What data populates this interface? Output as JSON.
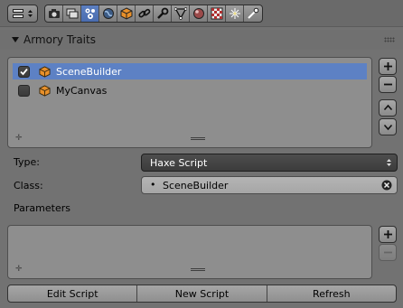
{
  "toolbar": {
    "editor_icon": "editor-type-icon",
    "tabs": [
      {
        "name": "render-icon",
        "active": false
      },
      {
        "name": "render-layers-icon",
        "active": false
      },
      {
        "name": "scene-icon",
        "active": true
      },
      {
        "name": "world-icon",
        "active": false
      },
      {
        "name": "object-icon",
        "active": false
      },
      {
        "name": "constraints-icon",
        "active": false
      },
      {
        "name": "modifiers-icon",
        "active": false
      },
      {
        "name": "data-icon",
        "active": false
      },
      {
        "name": "material-icon",
        "active": false
      },
      {
        "name": "texture-icon",
        "active": false
      },
      {
        "name": "particles-icon",
        "active": false
      },
      {
        "name": "physics-icon",
        "active": false
      }
    ]
  },
  "panel": {
    "title": "Armory Traits"
  },
  "traits": {
    "items": [
      {
        "label": "SceneBuilder",
        "checked": true,
        "selected": true
      },
      {
        "label": "MyCanvas",
        "checked": false,
        "selected": false
      }
    ]
  },
  "fields": {
    "type_label": "Type:",
    "type_value": "Haxe Script",
    "class_label": "Class:",
    "class_value": "SceneBuilder",
    "parameters_label": "Parameters"
  },
  "buttons": {
    "edit_script": "Edit Script",
    "new_script": "New Script",
    "refresh": "Refresh"
  },
  "colors": {
    "background": "#727272",
    "selection": "#5d81c4",
    "object_icon": "#e8902a"
  }
}
